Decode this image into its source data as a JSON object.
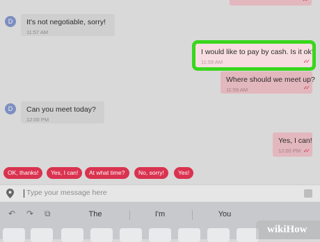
{
  "messages": [
    {
      "text": "It's not negotiable, sorry!",
      "time": "11:57 AM",
      "avatar": "D"
    },
    {
      "text": "I would like to pay by cash. Is it ok?",
      "time": "11:59 AM"
    },
    {
      "text": "Where should we meet up?",
      "time": "11:59 AM"
    },
    {
      "text": "Can you meet today?",
      "time": "12:00 PM",
      "avatar": "D"
    },
    {
      "text": "Yes, I can!",
      "time": "12:00 PM"
    }
  ],
  "quick_replies": [
    "OK, thanks!",
    "Yes, I can!",
    "At what time?",
    "No, sorry!",
    "Yes!"
  ],
  "input": {
    "placeholder": "Type your message here"
  },
  "keyboard": {
    "suggestions": [
      "The",
      "I'm",
      "You"
    ]
  },
  "watermark": {
    "wiki": "wiki",
    "how": "How"
  },
  "colors": {
    "focus_outline": "#39d61d",
    "accent": "#d9334f"
  }
}
